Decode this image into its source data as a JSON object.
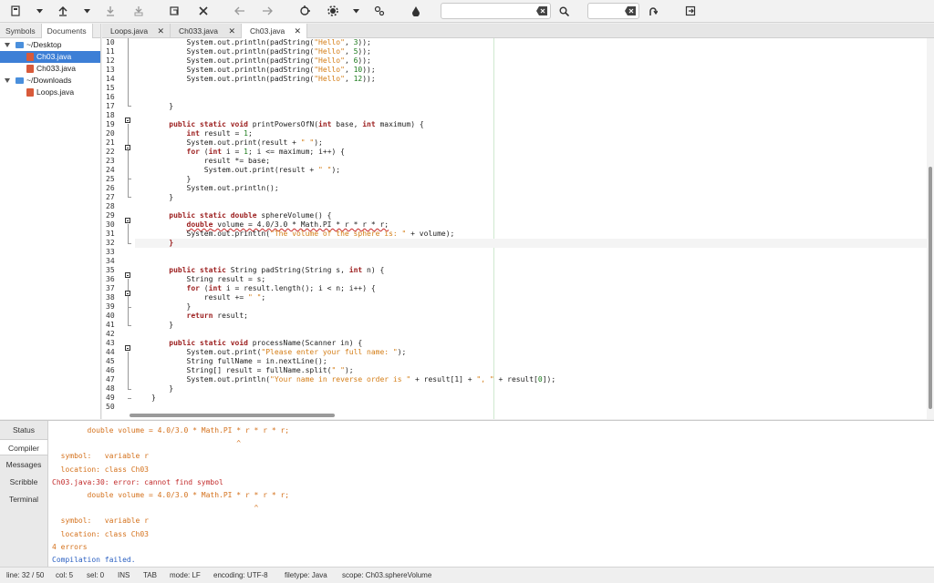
{
  "toolbar": {
    "buttons": [
      "new-icon",
      "open-icon",
      "save-icon",
      "save-all-icon",
      "reload-icon",
      "close-icon",
      "back-icon",
      "forward-icon",
      "compile-icon",
      "build-icon",
      "run-icon",
      "color-icon",
      "find-icon",
      "jump-to-line-icon",
      "quit-icon"
    ],
    "search_value": "",
    "goto_value": ""
  },
  "sidebar": {
    "tabs": [
      "Symbols",
      "Documents"
    ],
    "active_tab": "Documents",
    "tree": [
      {
        "label": "~/Desktop",
        "type": "folder"
      },
      {
        "label": "Ch03.java",
        "type": "file",
        "selected": true
      },
      {
        "label": "Ch033.java",
        "type": "file"
      },
      {
        "label": "~/Downloads",
        "type": "folder"
      },
      {
        "label": "Loops.java",
        "type": "file"
      }
    ]
  },
  "editor": {
    "tabs": [
      {
        "label": "Loops.java"
      },
      {
        "label": "Ch033.java"
      },
      {
        "label": "Ch03.java",
        "active": true
      }
    ],
    "line_numbers": [
      "10",
      "11",
      "12",
      "13",
      "14",
      "15",
      "16",
      "17",
      "18",
      "19",
      "20",
      "21",
      "22",
      "23",
      "24",
      "25",
      "26",
      "27",
      "28",
      "29",
      "30",
      "31",
      "32",
      "33",
      "34",
      "35",
      "36",
      "37",
      "38",
      "39",
      "40",
      "41",
      "42",
      "43",
      "44",
      "45",
      "46",
      "47",
      "48",
      "49",
      "50"
    ],
    "lines": [
      [
        [
          "        System.out.println(padString(",
          ""
        ],
        [
          "\"Hello\"",
          "str"
        ],
        [
          ", ",
          ""
        ],
        [
          "3",
          "num"
        ],
        [
          "));",
          ""
        ]
      ],
      [
        [
          "        System.out.println(padString(",
          ""
        ],
        [
          "\"Hello\"",
          "str"
        ],
        [
          ", ",
          ""
        ],
        [
          "5",
          "num"
        ],
        [
          "));",
          ""
        ]
      ],
      [
        [
          "        System.out.println(padString(",
          ""
        ],
        [
          "\"Hello\"",
          "str"
        ],
        [
          ", ",
          ""
        ],
        [
          "6",
          "num"
        ],
        [
          "));",
          ""
        ]
      ],
      [
        [
          "        System.out.println(padString(",
          ""
        ],
        [
          "\"Hello\"",
          "str"
        ],
        [
          ", ",
          ""
        ],
        [
          "10",
          "num"
        ],
        [
          "));",
          ""
        ]
      ],
      [
        [
          "        System.out.println(padString(",
          ""
        ],
        [
          "\"Hello\"",
          "str"
        ],
        [
          ", ",
          ""
        ],
        [
          "12",
          "num"
        ],
        [
          "));",
          ""
        ]
      ],
      [],
      [],
      [
        [
          "    }",
          ""
        ]
      ],
      [],
      [
        [
          "    ",
          ""
        ],
        [
          "public static void",
          "kw"
        ],
        [
          " printPowersOfN(",
          ""
        ],
        [
          "int",
          "kw"
        ],
        [
          " base, ",
          ""
        ],
        [
          "int",
          "kw"
        ],
        [
          " maximum) {",
          ""
        ]
      ],
      [
        [
          "        ",
          ""
        ],
        [
          "int",
          "kw"
        ],
        [
          " result = ",
          ""
        ],
        [
          "1",
          "num"
        ],
        [
          ";",
          ""
        ]
      ],
      [
        [
          "        System.out.print(result + ",
          ""
        ],
        [
          "\" \"",
          "str"
        ],
        [
          ");",
          ""
        ]
      ],
      [
        [
          "        ",
          ""
        ],
        [
          "for",
          "kw"
        ],
        [
          " (",
          ""
        ],
        [
          "int",
          "kw"
        ],
        [
          " i = ",
          ""
        ],
        [
          "1",
          "num"
        ],
        [
          "; i <= maximum; i++) {",
          ""
        ]
      ],
      [
        [
          "            result *= base;",
          ""
        ]
      ],
      [
        [
          "            System.out.print(result + ",
          ""
        ],
        [
          "\" \"",
          "str"
        ],
        [
          ");",
          ""
        ]
      ],
      [
        [
          "        }",
          ""
        ]
      ],
      [
        [
          "        System.out.println();",
          ""
        ]
      ],
      [
        [
          "    }",
          ""
        ]
      ],
      [],
      [
        [
          "    ",
          ""
        ],
        [
          "public static double",
          "kw"
        ],
        [
          " sphereVolume() {",
          ""
        ]
      ],
      [
        [
          "        ",
          ""
        ],
        [
          "double",
          "kw err"
        ],
        [
          " volume = 4.0/3.0 * Math.PI * r * r * r;",
          "err"
        ]
      ],
      [
        [
          "        System.out.println(",
          ""
        ],
        [
          "\"The volume of the sphere is: \"",
          "str"
        ],
        [
          " + volume);",
          ""
        ]
      ],
      [
        [
          "    }",
          "kw"
        ]
      ],
      [],
      [],
      [
        [
          "    ",
          ""
        ],
        [
          "public static",
          "kw"
        ],
        [
          " String padString(String s, ",
          ""
        ],
        [
          "int",
          "kw"
        ],
        [
          " n) {",
          ""
        ]
      ],
      [
        [
          "        String result = s;",
          ""
        ]
      ],
      [
        [
          "        ",
          ""
        ],
        [
          "for",
          "kw"
        ],
        [
          " (",
          ""
        ],
        [
          "int",
          "kw"
        ],
        [
          " i = result.length(); i < n; i++) {",
          ""
        ]
      ],
      [
        [
          "            result += ",
          ""
        ],
        [
          "\" \"",
          "str"
        ],
        [
          ";",
          ""
        ]
      ],
      [
        [
          "        }",
          ""
        ]
      ],
      [
        [
          "        ",
          ""
        ],
        [
          "return",
          "kw"
        ],
        [
          " result;",
          ""
        ]
      ],
      [
        [
          "    }",
          ""
        ]
      ],
      [],
      [
        [
          "    ",
          ""
        ],
        [
          "public static void",
          "kw"
        ],
        [
          " processName(Scanner in) {",
          ""
        ]
      ],
      [
        [
          "        System.out.print(",
          ""
        ],
        [
          "\"Please enter your full name: \"",
          "str"
        ],
        [
          ");",
          ""
        ]
      ],
      [
        [
          "        String fullName = in.nextLine();",
          ""
        ]
      ],
      [
        [
          "        String[] result = fullName.split(",
          ""
        ],
        [
          "\" \"",
          "str"
        ],
        [
          ");",
          ""
        ]
      ],
      [
        [
          "        System.out.println(",
          ""
        ],
        [
          "\"Your name in reverse order is \"",
          "str"
        ],
        [
          " + result[1] + ",
          ""
        ],
        [
          "\", \"",
          "str"
        ],
        [
          " + result[",
          ""
        ],
        [
          "0",
          "num"
        ],
        [
          "]);",
          ""
        ]
      ],
      [
        [
          "    }",
          ""
        ]
      ],
      [
        [
          "}",
          ""
        ]
      ],
      []
    ]
  },
  "messages": {
    "tabs": [
      "Status",
      "Compiler",
      "Messages",
      "Scribble",
      "Terminal"
    ],
    "active_tab": "Compiler",
    "lines": [
      {
        "text": "        double volume = 4.0/3.0 * Math.PI * r * r * r;",
        "style": "orange"
      },
      {
        "text": "                                          ^",
        "style": "orange"
      },
      {
        "text": "  symbol:   variable r",
        "style": "orange"
      },
      {
        "text": "  location: class Ch03",
        "style": "orange"
      },
      {
        "text": "Ch03.java:30: error: cannot find symbol",
        "style": "red"
      },
      {
        "text": "        double volume = 4.0/3.0 * Math.PI * r * r * r;",
        "style": "orange"
      },
      {
        "text": "                                              ^",
        "style": "orange"
      },
      {
        "text": "  symbol:   variable r",
        "style": "orange"
      },
      {
        "text": "  location: class Ch03",
        "style": "orange"
      },
      {
        "text": "4 errors",
        "style": "orange"
      },
      {
        "text": "Compilation failed.",
        "style": "blue"
      }
    ]
  },
  "statusbar": {
    "line": "line: 32 / 50",
    "col": "col: 5",
    "sel": "sel: 0",
    "ins": "INS",
    "tab": "TAB",
    "mode": "mode: LF",
    "encoding": "encoding: UTF-8",
    "filetype": "filetype: Java",
    "scope": "scope: Ch03.sphereVolume"
  },
  "colors": {
    "keyword": "#9b1d1d",
    "string": "#d47d16",
    "number": "#1a7a1a",
    "selection": "#3d7fd6",
    "error": "#c22b2b",
    "info": "#2a5fc1"
  }
}
